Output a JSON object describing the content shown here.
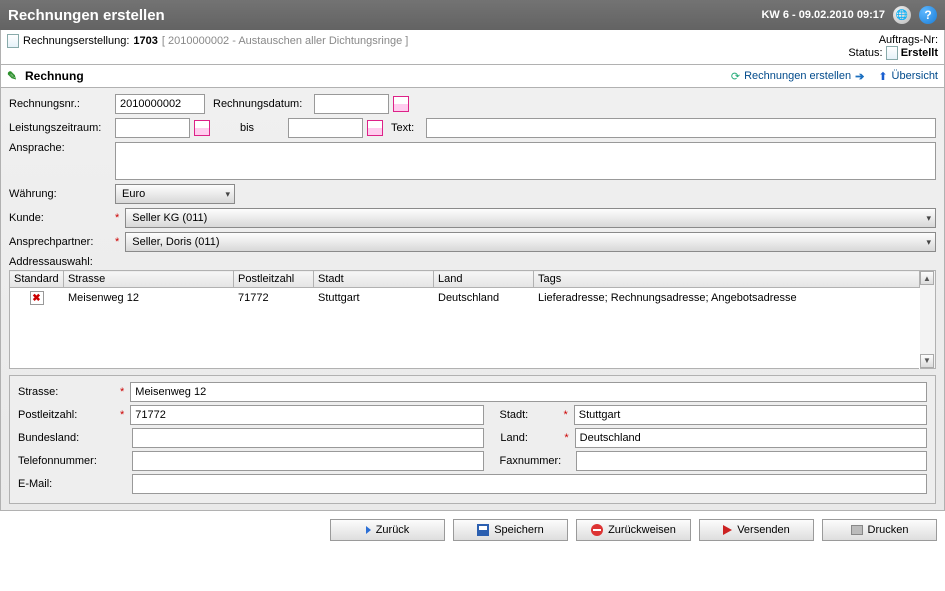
{
  "header": {
    "title": "Rechnungen erstellen",
    "kw": "KW 6 - 09.02.2010 09:17"
  },
  "sub": {
    "label": "Rechnungserstellung:",
    "num": "1703",
    "desc": "[ 2010000002 - Austauschen aller Dichtungsringe ]",
    "order_label": "Auftrags-Nr:",
    "order_value": "",
    "status_label": "Status:",
    "status_value": "Erstellt"
  },
  "section": {
    "title": "Rechnung",
    "link_create": "Rechnungen erstellen",
    "link_overview": "Übersicht"
  },
  "form": {
    "invoice_no_label": "Rechnungsnr.:",
    "invoice_no": "2010000002",
    "invoice_date_label": "Rechnungsdatum:",
    "invoice_date": "",
    "period_label": "Leistungszeitraum:",
    "period_from": "",
    "period_to_label": "bis",
    "period_to": "",
    "text_label": "Text:",
    "text": "",
    "salutation_label": "Ansprache:",
    "salutation": "",
    "currency_label": "Währung:",
    "currency": "Euro",
    "customer_label": "Kunde:",
    "customer": "Seller KG (011)",
    "contact_label": "Ansprechpartner:",
    "contact": "Seller, Doris (011)",
    "addr_select_label": "Addressauswahl:"
  },
  "addr_table": {
    "cols": {
      "standard": "Standard",
      "street": "Strasse",
      "zip": "Postleitzahl",
      "city": "Stadt",
      "country": "Land",
      "tags": "Tags"
    },
    "row": {
      "street": "Meisenweg 12",
      "zip": "71772",
      "city": "Stuttgart",
      "country": "Deutschland",
      "tags": "Lieferadresse; Rechnungsadresse; Angebotsadresse"
    }
  },
  "addr_form": {
    "street_label": "Strasse:",
    "street": "Meisenweg 12",
    "zip_label": "Postleitzahl:",
    "zip": "71772",
    "city_label": "Stadt:",
    "city": "Stuttgart",
    "state_label": "Bundesland:",
    "state": "",
    "country_label": "Land:",
    "country": "Deutschland",
    "phone_label": "Telefonnummer:",
    "phone": "",
    "fax_label": "Faxnummer:",
    "fax": "",
    "email_label": "E-Mail:",
    "email": ""
  },
  "footer": {
    "back": "Zurück",
    "save": "Speichern",
    "reject": "Zurückweisen",
    "send": "Versenden",
    "print": "Drucken"
  }
}
